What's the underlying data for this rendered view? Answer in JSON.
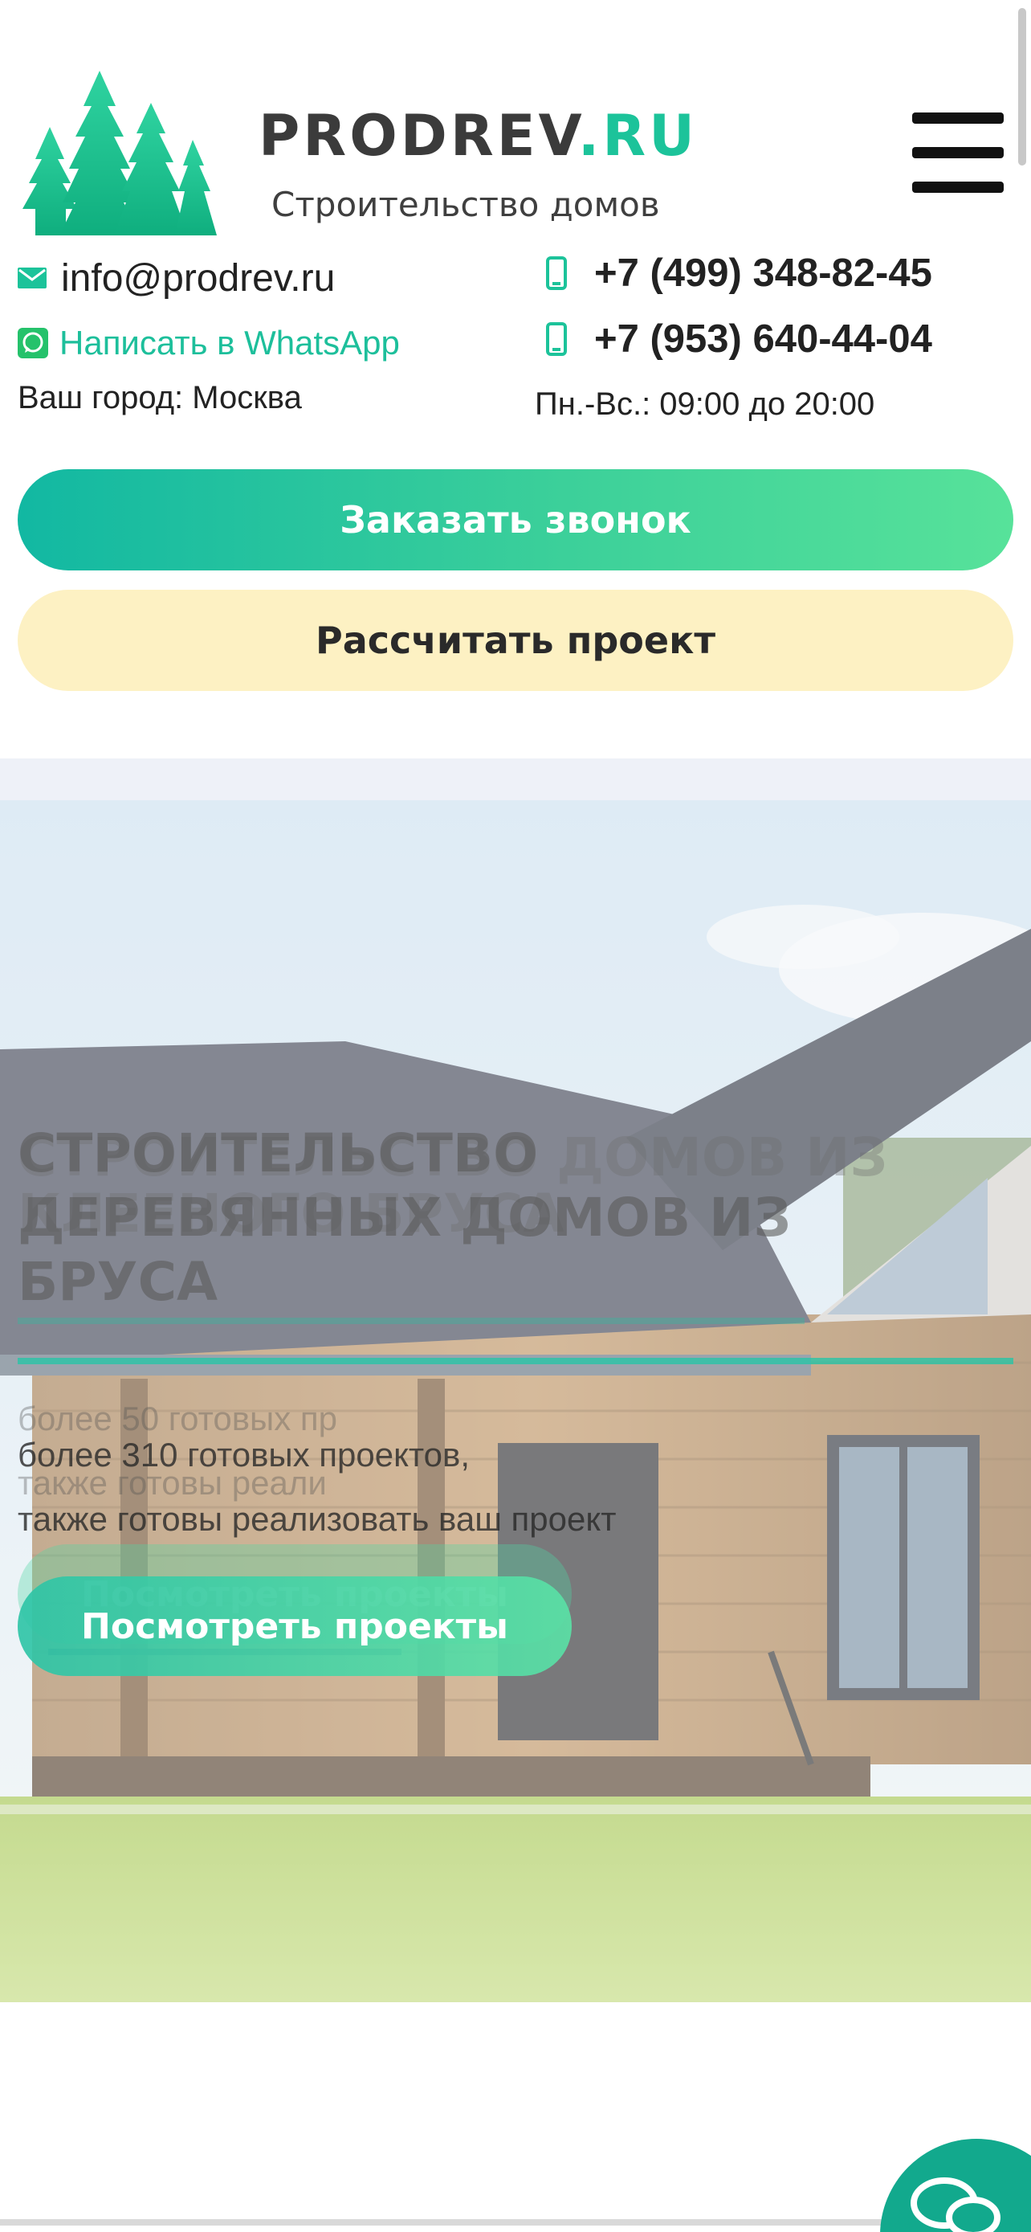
{
  "header": {
    "logo_brand": "PRODREV",
    "logo_domain": ".RU",
    "logo_tagline": "Строительство домов",
    "menu_icon": "hamburger-icon"
  },
  "contacts": {
    "email": "info@prodrev.ru",
    "whatsapp_label": "Написать в WhatsApp",
    "city": "Ваш город: Москва",
    "phone_1": "+7 (499) 348-82-45",
    "phone_2": "+7 (953) 640-44-04",
    "hours": "Пн.-Вс.: 09:00 до 20:00",
    "icons": [
      "mail-icon",
      "whatsapp-icon",
      "mobile-phone-icon"
    ]
  },
  "buttons": {
    "call": "Заказать звонок",
    "calculate": "Рассчитать проект"
  },
  "hero": {
    "title_ghost": "СТРОИТЕЛЬСТВО ДОМОВ ИЗ",
    "title_ghost_2": "КЛЕЕНОГО БРУСА",
    "title_line_1": "СТРОИТЕЛЬСТВО",
    "title_line_2": "ДЕРЕВЯННЫХ ДОМОВ ИЗ",
    "title_line_3": "БРУСА",
    "subtitle_ghost_1": "более 50 готовых пр",
    "subtitle_ghost_2": "также готовы реали",
    "subtitle_line_1": "более 310 готовых проектов,",
    "subtitle_line_2": "также готовы реализовать ваш проект",
    "button_ghost": "Посмотреть проекты",
    "button": "Посмотреть проекты"
  },
  "colors": {
    "accent": "#1cc39a",
    "call_gradient_start": "#12b8a2",
    "call_gradient_end": "#57e29a",
    "calc_bg": "#fdf1c3",
    "chat_fab": "#12a98d"
  },
  "chat": {
    "icon": "chat-bubbles-icon"
  }
}
